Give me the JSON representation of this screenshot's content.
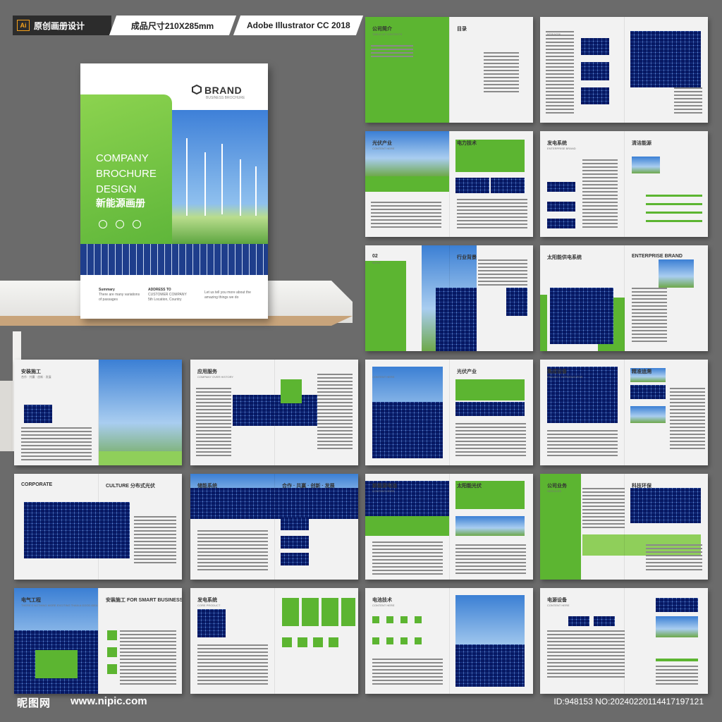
{
  "header": {
    "ai_badge": "Ai",
    "label1": "原创画册设计",
    "label2": "成品尺寸210X285mm",
    "label3": "Adobe Illustrator CC 2018"
  },
  "cover": {
    "brand": "BRAND",
    "brand_sub": "BUSINESS BROCHURE",
    "title_en_1": "COMPANY",
    "title_en_2": "BROCHURE",
    "title_en_3": "DESIGN",
    "title_cn": "新能源画册",
    "foot_summary_title": "Summary",
    "foot_summary": "There are many variations of passages",
    "foot_address_title": "ADDRESS TO",
    "foot_address": "CUSTOMER COMPANY 5th Location, Country",
    "foot_tell": "Let us tell you more about the amazing things we do"
  },
  "spreads": [
    {
      "title": "公司简介",
      "title2": "目录",
      "sub": "TABLE OF CONTENTS"
    },
    {
      "title": "",
      "title2": "",
      "sub": "N°05   N°06"
    },
    {
      "title": "光伏产业",
      "title2": "电力技术",
      "sub": "CONTENT HERE"
    },
    {
      "title": "发电系统",
      "title2": "清洁能源",
      "sub": "ENTERPRISE BRAND"
    },
    {
      "title": "02",
      "title2": "行业背景",
      "sub": "98.5%"
    },
    {
      "title": "太阳能供电系统",
      "title2": "ENTERPRISE BRAND",
      "sub": ""
    },
    {
      "title": "安装施工",
      "title2": "",
      "sub": "合作 · 共赢 · 创新 · 发展"
    },
    {
      "title": "应用服务",
      "title2": "",
      "sub": "COMPANY OVER HISTORY"
    },
    {
      "title": "",
      "title2": "光伏产业",
      "sub": "CONTENT HERE"
    },
    {
      "title": "集成设备",
      "title2": "精准追溯",
      "sub": "PROJECT INTRODUCTION"
    },
    {
      "title": "CORPORATE",
      "title2": "CULTURE 分布式光伏",
      "sub": ""
    },
    {
      "title": "储能系统",
      "title2": "合作 · 共赢 · 创新 · 发展",
      "sub": ""
    },
    {
      "title": "新能源电池",
      "title2": "太阳能光伏",
      "sub": "CONTENT HERE"
    },
    {
      "title": "公司业务",
      "title2": "科技环保",
      "sub": "SERVICES"
    },
    {
      "title": "电气工程",
      "title2": "安装施工 FOR SMART BUSINESS",
      "sub": "THERE'S NOTHING MORE EXCITING THAN A GOOD IDEA"
    },
    {
      "title": "发电系统",
      "title2": "",
      "sub": "CORE PRODUCT"
    },
    {
      "title": "电池技术",
      "title2": "",
      "sub": "CONTENT HERE"
    },
    {
      "title": "电源设备",
      "title2": "",
      "sub": "CONTENT HERE"
    }
  ],
  "footer": {
    "logo": "昵图网",
    "url": "www.nipic.com",
    "id": "ID:948153 NO:20240220114417197121"
  },
  "colors": {
    "accent": "#5cb531",
    "solar": "#2a4f9e",
    "background": "#6b6b6b"
  }
}
